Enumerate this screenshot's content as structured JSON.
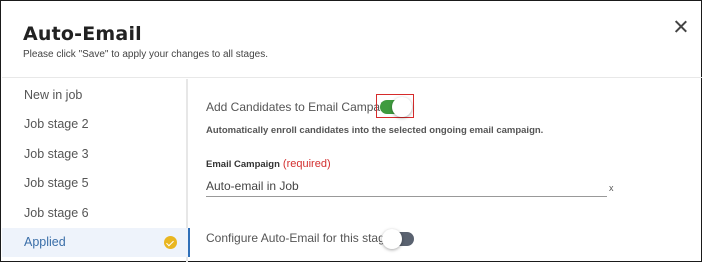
{
  "dialog": {
    "title": "Auto-Email",
    "subtitle": "Please click \"Save\" to apply your changes to all stages."
  },
  "sidebar": {
    "items": [
      {
        "label": "New in job",
        "active": false
      },
      {
        "label": "Job stage 2",
        "active": false
      },
      {
        "label": "Job stage 3",
        "active": false
      },
      {
        "label": "Job stage 5",
        "active": false
      },
      {
        "label": "Job stage 6",
        "active": false
      },
      {
        "label": "Applied",
        "active": true,
        "status_icon": "check-circle-icon"
      }
    ]
  },
  "main": {
    "add_candidates": {
      "label": "Add Candidates to Email Campaign",
      "enabled": true,
      "description": "Automatically enroll candidates into the selected ongoing email campaign."
    },
    "email_campaign": {
      "label": "Email Campaign",
      "required": "(required)",
      "value": "Auto-email in Job",
      "clear_label": "x"
    },
    "configure_auto_email": {
      "label": "Configure Auto-Email for this stage",
      "enabled": false
    }
  },
  "colors": {
    "toggle_on": "#3f9b3f",
    "toggle_off": "#5a6270",
    "active_item": "#3a6ea8",
    "required": "#d32f2f",
    "check_badge": "#e9b621",
    "highlight_box": "#d62b2b"
  }
}
